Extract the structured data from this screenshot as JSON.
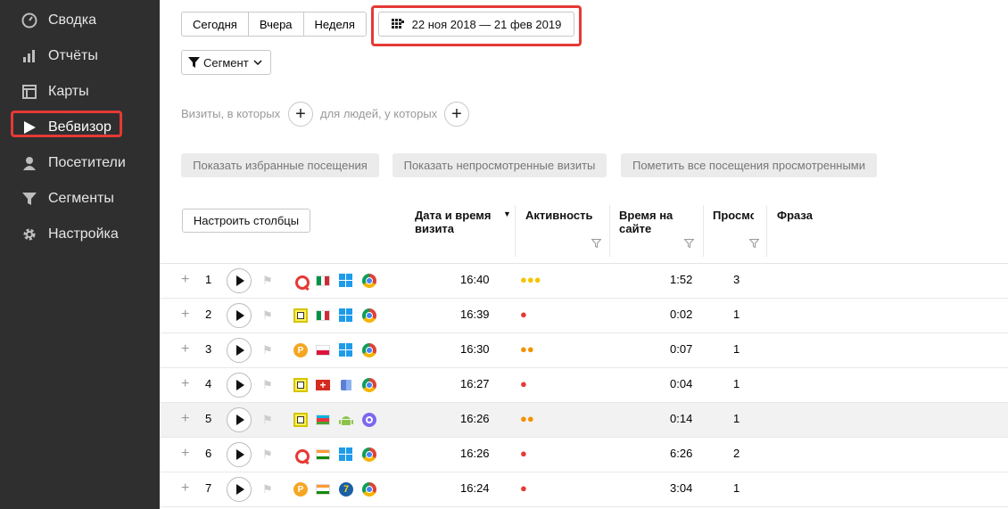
{
  "sidebar": {
    "items": [
      {
        "label": "Сводка",
        "icon": "gauge-icon"
      },
      {
        "label": "Отчёты",
        "icon": "bar-chart-icon"
      },
      {
        "label": "Карты",
        "icon": "map-icon"
      },
      {
        "label": "Вебвизор",
        "icon": "play-icon"
      },
      {
        "label": "Посетители",
        "icon": "user-icon"
      },
      {
        "label": "Сегменты",
        "icon": "filter-icon"
      },
      {
        "label": "Настройка",
        "icon": "gear-icon"
      }
    ],
    "active": "Вебвизор"
  },
  "period": {
    "today": "Сегодня",
    "yesterday": "Вчера",
    "week": "Неделя",
    "range": "22 ноя 2018 — 21 фев 2019"
  },
  "segment": {
    "label": "Сегмент"
  },
  "conditions": {
    "visits_label": "Визиты, в которых",
    "people_label": "для людей, у которых"
  },
  "actions": {
    "favorites": "Показать избранные посещения",
    "unviewed": "Показать непросмотренные визиты",
    "mark_all": "Пометить все посещения просмотренными"
  },
  "table": {
    "configure_columns": "Настроить столбцы",
    "headers": {
      "datetime_1": "Дата и время",
      "datetime_2": "визита",
      "activity": "Активность",
      "time_1": "Время на",
      "time_2": "сайте",
      "pageviews": "Просмо",
      "phrase": "Фраза"
    },
    "rows": [
      {
        "n": "1",
        "time": "16:40",
        "activity_dots": 3,
        "activity_color": "#f5c400",
        "duration": "1:52",
        "views": "3",
        "icons": [
          "search-engine-icon",
          "flag-italy-icon",
          "windows-icon",
          "chrome-icon"
        ]
      },
      {
        "n": "2",
        "time": "16:39",
        "activity_dots": 1,
        "activity_color": "#e53935",
        "duration": "0:02",
        "views": "1",
        "icons": [
          "direct-ad-icon",
          "flag-italy-icon",
          "windows-icon",
          "chrome-icon"
        ]
      },
      {
        "n": "3",
        "time": "16:30",
        "activity_dots": 2,
        "activity_color": "#f39200",
        "duration": "0:07",
        "views": "1",
        "icons": [
          "ad-network-icon",
          "flag-poland-icon",
          "windows-icon",
          "chrome-icon"
        ]
      },
      {
        "n": "4",
        "time": "16:27",
        "activity_dots": 1,
        "activity_color": "#e53935",
        "duration": "0:04",
        "views": "1",
        "icons": [
          "direct-ad-icon",
          "flag-switzerland-icon",
          "mac-os-icon",
          "chrome-icon"
        ]
      },
      {
        "n": "5",
        "time": "16:26",
        "activity_dots": 2,
        "activity_color": "#f39200",
        "duration": "0:14",
        "views": "1",
        "icons": [
          "direct-ad-icon",
          "flag-azerbaijan-icon",
          "android-icon",
          "browser-icon"
        ]
      },
      {
        "n": "6",
        "time": "16:26",
        "activity_dots": 1,
        "activity_color": "#e53935",
        "duration": "6:26",
        "views": "2",
        "icons": [
          "search-engine-icon",
          "flag-india-icon",
          "windows-icon",
          "chrome-icon"
        ]
      },
      {
        "n": "7",
        "time": "16:24",
        "activity_dots": 1,
        "activity_color": "#e53935",
        "duration": "3:04",
        "views": "1",
        "icons": [
          "ad-network-icon",
          "flag-india-icon",
          "windows-7-icon",
          "chrome-icon"
        ]
      }
    ],
    "selected_row": 5
  },
  "colors": {
    "sidebar_bg": "#2f2f2f",
    "highlight": "#e53935"
  }
}
